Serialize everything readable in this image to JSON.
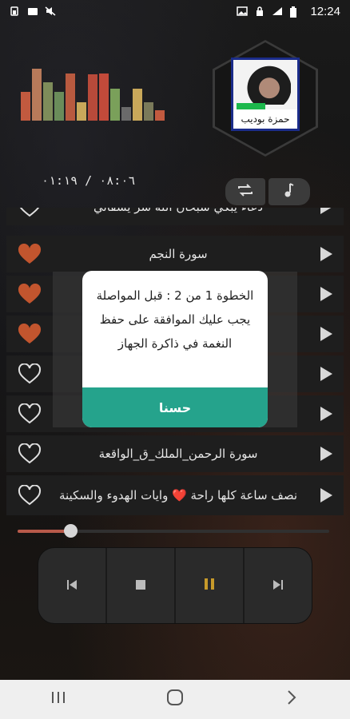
{
  "status_bar": {
    "time": "12:24"
  },
  "equalizer": {
    "levels": [
      0.55,
      0.98,
      0.72,
      0.55,
      0.9,
      0.35,
      0.88,
      0.9,
      0.6,
      0.25,
      0.6,
      0.35,
      0.2
    ],
    "colors": [
      "#c25a3f",
      "#b87a5a",
      "#7e8c5a",
      "#6a8c5a",
      "#b85a3f",
      "#c9a85a",
      "#b84a3a",
      "#c24a3a",
      "#7aa05a",
      "#6a6a6a",
      "#c9a85a",
      "#7a7a5a",
      "#c25a3f"
    ]
  },
  "album": {
    "caption": "حمزة بوديب"
  },
  "player": {
    "time_readout": "٠٨:٠٦ / ٠١:١٩",
    "repeat_icon": "repeat-icon",
    "music_icon": "music-note-icon",
    "seek_progress": 0.17
  },
  "playlist": {
    "items": [
      {
        "title": "دعاء يبكي سبحان الله شر يشفاني",
        "liked": false
      },
      {
        "title": "سورة النجم",
        "liked": true
      },
      {
        "title": "",
        "liked": true
      },
      {
        "title": "",
        "liked": true
      },
      {
        "title": "",
        "liked": false
      },
      {
        "title": "",
        "liked": false
      },
      {
        "title": "سورة الرحمن_الملك_ق_الواقعة",
        "liked": false
      },
      {
        "title": "نصف ساعة كلها راحة ❤️ وايات الهدوء والسكينة",
        "liked": false
      }
    ]
  },
  "dialog": {
    "message": "الخطوة 1 من 2 : قبل المواصلة يجب عليك الموافقة على حفظ النغمة في ذاكرة الجهاز",
    "ok_label": "حسنا"
  },
  "transport": {
    "prev": "⏮",
    "stop": "■",
    "pause": "❚❚",
    "next": "⏭"
  },
  "colors": {
    "accent": "#25a38c",
    "heart_liked": "#c2552e",
    "pause_color": "#c79a2a"
  }
}
